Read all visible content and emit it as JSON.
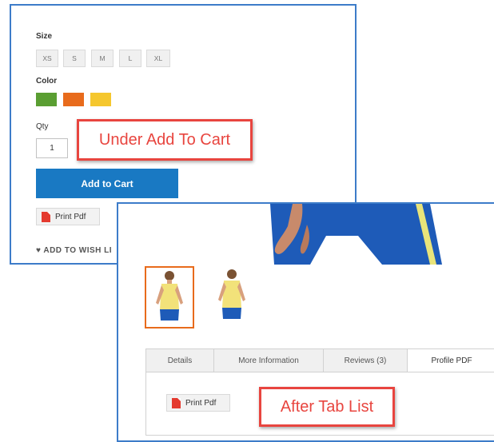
{
  "top_panel": {
    "size_label": "Size",
    "sizes": [
      "XS",
      "S",
      "M",
      "L",
      "XL"
    ],
    "color_label": "Color",
    "colors": [
      "#5a9e32",
      "#e86b1c",
      "#f5c72e"
    ],
    "qty_label": "Qty",
    "qty_value": "1",
    "callout": "Under Add To Cart",
    "add_to_cart": "Add to Cart",
    "print_pdf": "Print Pdf",
    "wishlist": "ADD TO WISH LI"
  },
  "bottom_panel": {
    "tabs": [
      "Details",
      "More Information",
      "Reviews (3)",
      "Profile PDF"
    ],
    "active_tab": "Profile PDF",
    "print_pdf": "Print Pdf",
    "callout": "After Tab List"
  },
  "colors": {
    "panel_border": "#3d7cc9",
    "callout": "#e8453f",
    "primary_button": "#1979c3"
  }
}
